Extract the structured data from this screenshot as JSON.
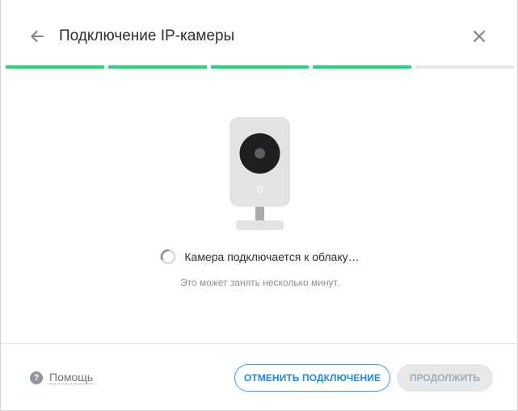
{
  "header": {
    "title": "Подключение IP-камеры",
    "back_icon": "arrow-left-icon",
    "close_icon": "close-icon"
  },
  "progress": {
    "steps_total": 5,
    "steps_done": 4,
    "done_color": "#1ed779",
    "pending_color": "#e6e8ea"
  },
  "illustration": {
    "icon": "ip-camera-icon",
    "indicator_text": "0"
  },
  "status": {
    "spinner_icon": "loading-spinner-icon",
    "text": "Камера подключается к облаку…",
    "hint": "Это может занять несколько минут."
  },
  "footer": {
    "help_icon": "question-circle-icon",
    "help_glyph": "?",
    "help_label": "Помощь",
    "cancel_label": "ОТМЕНИТЬ ПОДКЛЮЧЕНИЕ",
    "continue_label": "ПРОДОЛЖИТЬ",
    "accent_color": "#2e9be6"
  }
}
